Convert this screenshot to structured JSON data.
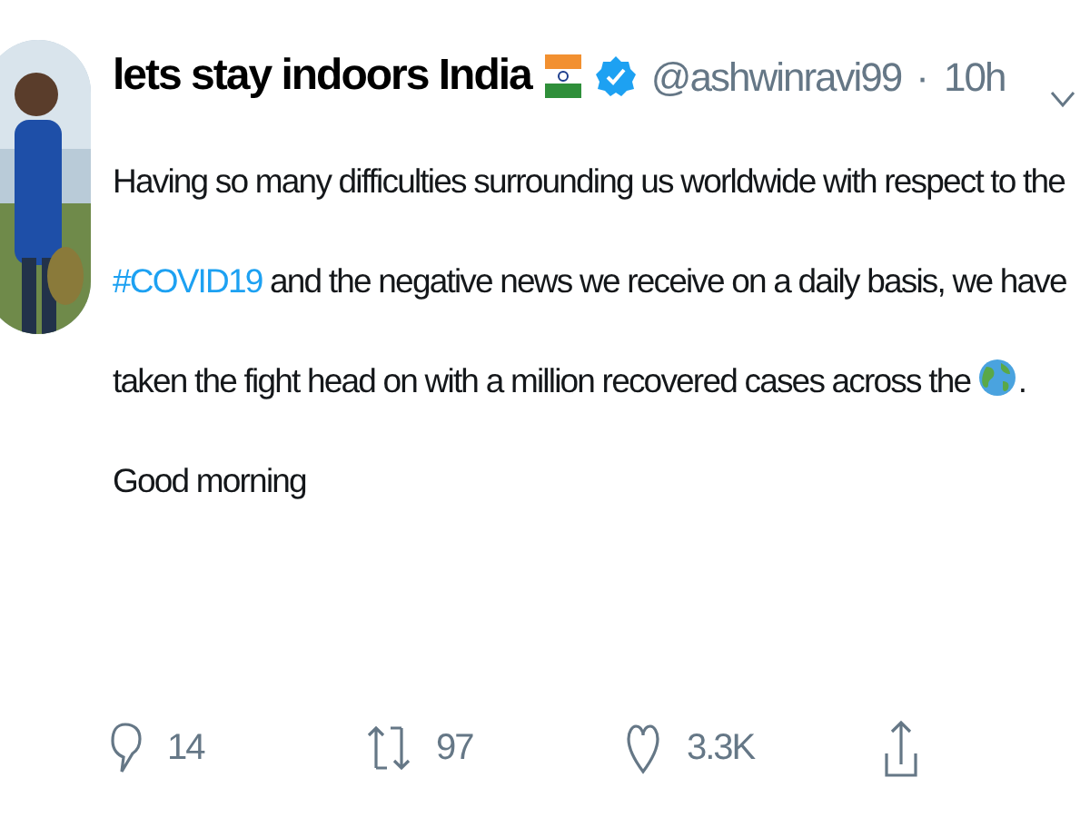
{
  "author": {
    "name": "lets stay indoors India",
    "verified": true,
    "handle": "@ashwinravi99",
    "separator": "·",
    "time": "10h"
  },
  "body": {
    "text_before": "Having so many difficulties surrounding us worldwide with respect to the ",
    "hashtag": "#COVID19",
    "text_middle": " and the negative news we receive on a daily basis, we have taken the fight head on with a million recovered cases across the ",
    "text_after": ".  Good morning"
  },
  "actions": [
    {
      "kind": "reply",
      "count": "14"
    },
    {
      "kind": "retweet",
      "count": "97"
    },
    {
      "kind": "like",
      "count": "3.3K"
    },
    {
      "kind": "share"
    }
  ]
}
